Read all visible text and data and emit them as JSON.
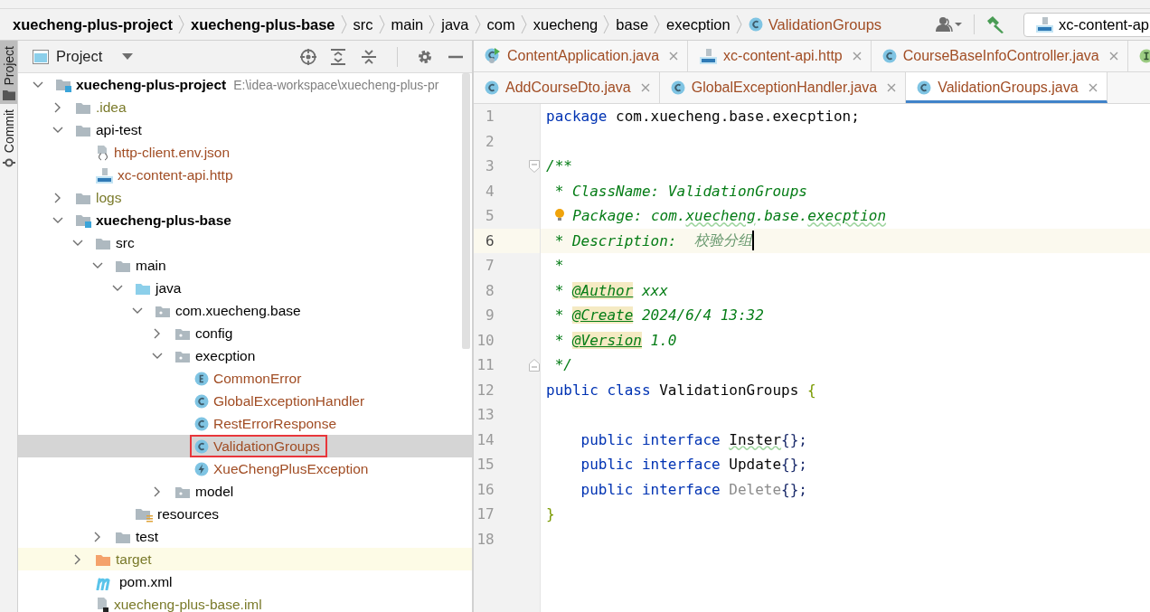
{
  "breadcrumbs": [
    {
      "label": "xuecheng-plus-project",
      "kind": "module"
    },
    {
      "label": "xuecheng-plus-base",
      "kind": "module"
    },
    {
      "label": "src",
      "kind": "folder"
    },
    {
      "label": "main",
      "kind": "folder"
    },
    {
      "label": "java",
      "kind": "folder"
    },
    {
      "label": "com",
      "kind": "folder"
    },
    {
      "label": "xuecheng",
      "kind": "folder"
    },
    {
      "label": "base",
      "kind": "folder"
    },
    {
      "label": "execption",
      "kind": "folder"
    },
    {
      "label": "ValidationGroups",
      "kind": "class"
    }
  ],
  "toolbar": {
    "run_config": "xc-content-ap"
  },
  "tool_strip": [
    {
      "label": "Project",
      "kind": "project",
      "selected": true
    },
    {
      "label": "Commit",
      "kind": "commit",
      "selected": false
    }
  ],
  "project_panel": {
    "title": "Project",
    "tree": [
      {
        "label": "xuecheng-plus-project",
        "kind": "module",
        "path": "E:\\idea-workspace\\xuecheng-plus-pr",
        "expanded": true,
        "selected": false,
        "children": [
          {
            "label": ".idea",
            "kind": "folder",
            "color": "#7a7a2a",
            "expanded": false,
            "selected": false
          },
          {
            "label": "api-test",
            "kind": "folder",
            "expanded": true,
            "selected": false,
            "children": [
              {
                "label": "http-client.env.json",
                "kind": "json",
                "color": "#a14d24",
                "selected": false
              },
              {
                "label": "xc-content-api.http",
                "kind": "http",
                "color": "#a14d24",
                "selected": false
              }
            ]
          },
          {
            "label": "logs",
            "kind": "folder",
            "color": "#7a7a2a",
            "expanded": false,
            "selected": false
          },
          {
            "label": "xuecheng-plus-base",
            "kind": "module",
            "expanded": true,
            "selected": false,
            "children": [
              {
                "label": "src",
                "kind": "folder",
                "expanded": true,
                "selected": false,
                "children": [
                  {
                    "label": "main",
                    "kind": "folder",
                    "expanded": true,
                    "selected": false,
                    "children": [
                      {
                        "label": "java",
                        "kind": "source",
                        "expanded": true,
                        "selected": false,
                        "children": [
                          {
                            "label": "com.xuecheng.base",
                            "kind": "package",
                            "expanded": true,
                            "selected": false,
                            "children": [
                              {
                                "label": "config",
                                "kind": "package",
                                "expanded": false,
                                "selected": false
                              },
                              {
                                "label": "execption",
                                "kind": "package",
                                "expanded": true,
                                "selected": false,
                                "children": [
                                  {
                                    "label": "CommonError",
                                    "kind": "enum",
                                    "color": "#a14d24",
                                    "selected": false
                                  },
                                  {
                                    "label": "GlobalExceptionHandler",
                                    "kind": "class",
                                    "color": "#a14d24",
                                    "selected": false
                                  },
                                  {
                                    "label": "RestErrorResponse",
                                    "kind": "class",
                                    "color": "#a14d24",
                                    "selected": false
                                  },
                                  {
                                    "label": "ValidationGroups",
                                    "kind": "class",
                                    "color": "#a14d24",
                                    "selected": true,
                                    "marked": true
                                  },
                                  {
                                    "label": "XueChengPlusException",
                                    "kind": "exception",
                                    "color": "#a14d24",
                                    "selected": false
                                  }
                                ]
                              },
                              {
                                "label": "model",
                                "kind": "package",
                                "expanded": false,
                                "selected": false
                              }
                            ]
                          }
                        ]
                      },
                      {
                        "label": "resources",
                        "kind": "resources",
                        "selected": false
                      }
                    ]
                  },
                  {
                    "label": "test",
                    "kind": "folder",
                    "expanded": false,
                    "selected": false
                  }
                ]
              },
              {
                "label": "target",
                "kind": "excluded",
                "color": "#7a7a2a",
                "expanded": false,
                "selected": false
              },
              {
                "label": "pom.xml",
                "kind": "maven",
                "selected": false
              },
              {
                "label": "xuecheng-plus-base.iml",
                "kind": "iml",
                "color": "#7a7a2a",
                "selected": false
              }
            ]
          }
        ]
      }
    ]
  },
  "editor_tabs": [
    [
      {
        "label": "ContentApplication.java",
        "kind": "run-class",
        "selected": false
      },
      {
        "label": "xc-content-api.http",
        "kind": "http",
        "selected": false
      },
      {
        "label": "CourseBaseInfoController.java",
        "kind": "class",
        "selected": false
      },
      {
        "kind": "interface",
        "selected": false
      }
    ],
    [
      {
        "label": "AddCourseDto.java",
        "kind": "class",
        "selected": false
      },
      {
        "label": "GlobalExceptionHandler.java",
        "kind": "class",
        "selected": false
      },
      {
        "label": "ValidationGroups.java",
        "kind": "class",
        "selected": true
      }
    ]
  ],
  "code": [
    {
      "number": "1",
      "current": false,
      "tokens": [
        {
          "kind": "keyword",
          "text": "package"
        },
        {
          "kind": "plain",
          "text": " com.xuecheng.base.execption;"
        }
      ]
    },
    {
      "number": "2",
      "current": false
    },
    {
      "number": "3",
      "current": false,
      "kind": "fold-start",
      "tokens": [
        {
          "kind": "doc",
          "text": "/**"
        }
      ]
    },
    {
      "number": "4",
      "current": false,
      "tokens": [
        {
          "kind": "doc",
          "text": " * ClassName: ValidationGroups"
        }
      ]
    },
    {
      "number": "5",
      "current": false,
      "tokens": [
        {
          "kind": "bulb"
        },
        {
          "kind": "doc",
          "text": " Package: com."
        },
        {
          "kind": "doc-typo",
          "text": "xuecheng"
        },
        {
          "kind": "doc",
          "text": ".base."
        },
        {
          "kind": "doc-typo",
          "text": "execption"
        }
      ]
    },
    {
      "number": "6",
      "current": true,
      "tokens": [
        {
          "kind": "doc",
          "text": " * Description:  "
        },
        {
          "kind": "doc-cn",
          "text": "校验分组"
        }
      ]
    },
    {
      "number": "7",
      "current": false,
      "tokens": [
        {
          "kind": "doc",
          "text": " *"
        }
      ]
    },
    {
      "number": "8",
      "current": false,
      "tokens": [
        {
          "kind": "doc",
          "text": " * "
        },
        {
          "kind": "tag",
          "text": "@Author"
        },
        {
          "kind": "doc",
          "text": " xxx"
        }
      ]
    },
    {
      "number": "9",
      "current": false,
      "tokens": [
        {
          "kind": "doc",
          "text": " * "
        },
        {
          "kind": "tag",
          "text": "@Create"
        },
        {
          "kind": "doc",
          "text": " 2024/6/4 13:32"
        }
      ]
    },
    {
      "number": "10",
      "current": false,
      "tokens": [
        {
          "kind": "doc",
          "text": " * "
        },
        {
          "kind": "tag",
          "text": "@Version"
        },
        {
          "kind": "doc",
          "text": " 1.0"
        }
      ]
    },
    {
      "number": "11",
      "current": false,
      "kind": "fold-end",
      "tokens": [
        {
          "kind": "doc",
          "text": " */"
        }
      ]
    },
    {
      "number": "12",
      "current": false,
      "tokens": [
        {
          "kind": "keyword",
          "text": "public class"
        },
        {
          "kind": "plain",
          "text": " ValidationGroups "
        },
        {
          "kind": "brace",
          "text": "{"
        }
      ]
    },
    {
      "number": "13",
      "current": false
    },
    {
      "number": "14",
      "current": false,
      "tokens": [
        {
          "kind": "keyword",
          "text": "    public interface "
        },
        {
          "kind": "typo",
          "text": "Inster"
        },
        {
          "kind": "punct",
          "text": "{};"
        }
      ]
    },
    {
      "number": "15",
      "current": false,
      "tokens": [
        {
          "kind": "keyword",
          "text": "    public interface "
        },
        {
          "kind": "plain",
          "text": "Update"
        },
        {
          "kind": "punct",
          "text": "{};"
        }
      ]
    },
    {
      "number": "16",
      "current": false,
      "tokens": [
        {
          "kind": "keyword",
          "text": "    public interface "
        },
        {
          "kind": "unused",
          "text": "Delete"
        },
        {
          "kind": "punct",
          "text": "{};"
        }
      ]
    },
    {
      "number": "17",
      "current": false,
      "tokens": [
        {
          "kind": "brace",
          "text": "}"
        }
      ]
    },
    {
      "number": "18",
      "current": false
    }
  ]
}
